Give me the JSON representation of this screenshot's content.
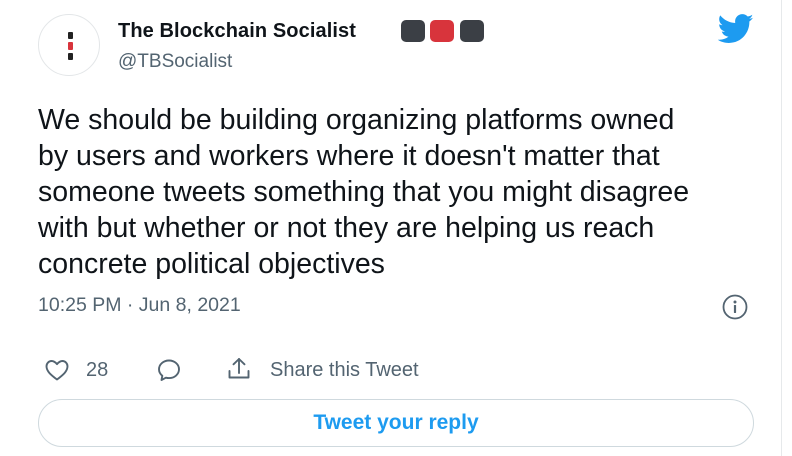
{
  "author": {
    "display_name": "The Blockchain Socialist",
    "handle": "@TBSocialist"
  },
  "tweet": {
    "text": "We should be building organizing platforms owned\nby users and workers where it doesn't matter that\nsomeone tweets something that you might disagree\nwith but whether or not they are helping us reach\nconcrete political objectives",
    "timestamp": "10:25 PM · Jun 8, 2021"
  },
  "actions": {
    "like_count": "28",
    "share_label": "Share this Tweet"
  },
  "reply_button": {
    "label": "Tweet your reply"
  },
  "colors": {
    "twitter_blue": "#1d9bf0",
    "muted_text": "#536471",
    "flag_red": "#d8343c",
    "flag_dark": "#3b3f45"
  },
  "icons": {
    "logo": "twitter-bird-icon",
    "info": "info-circle-icon",
    "like": "heart-icon",
    "reply": "reply-bubble-icon",
    "share": "share-upload-icon"
  }
}
